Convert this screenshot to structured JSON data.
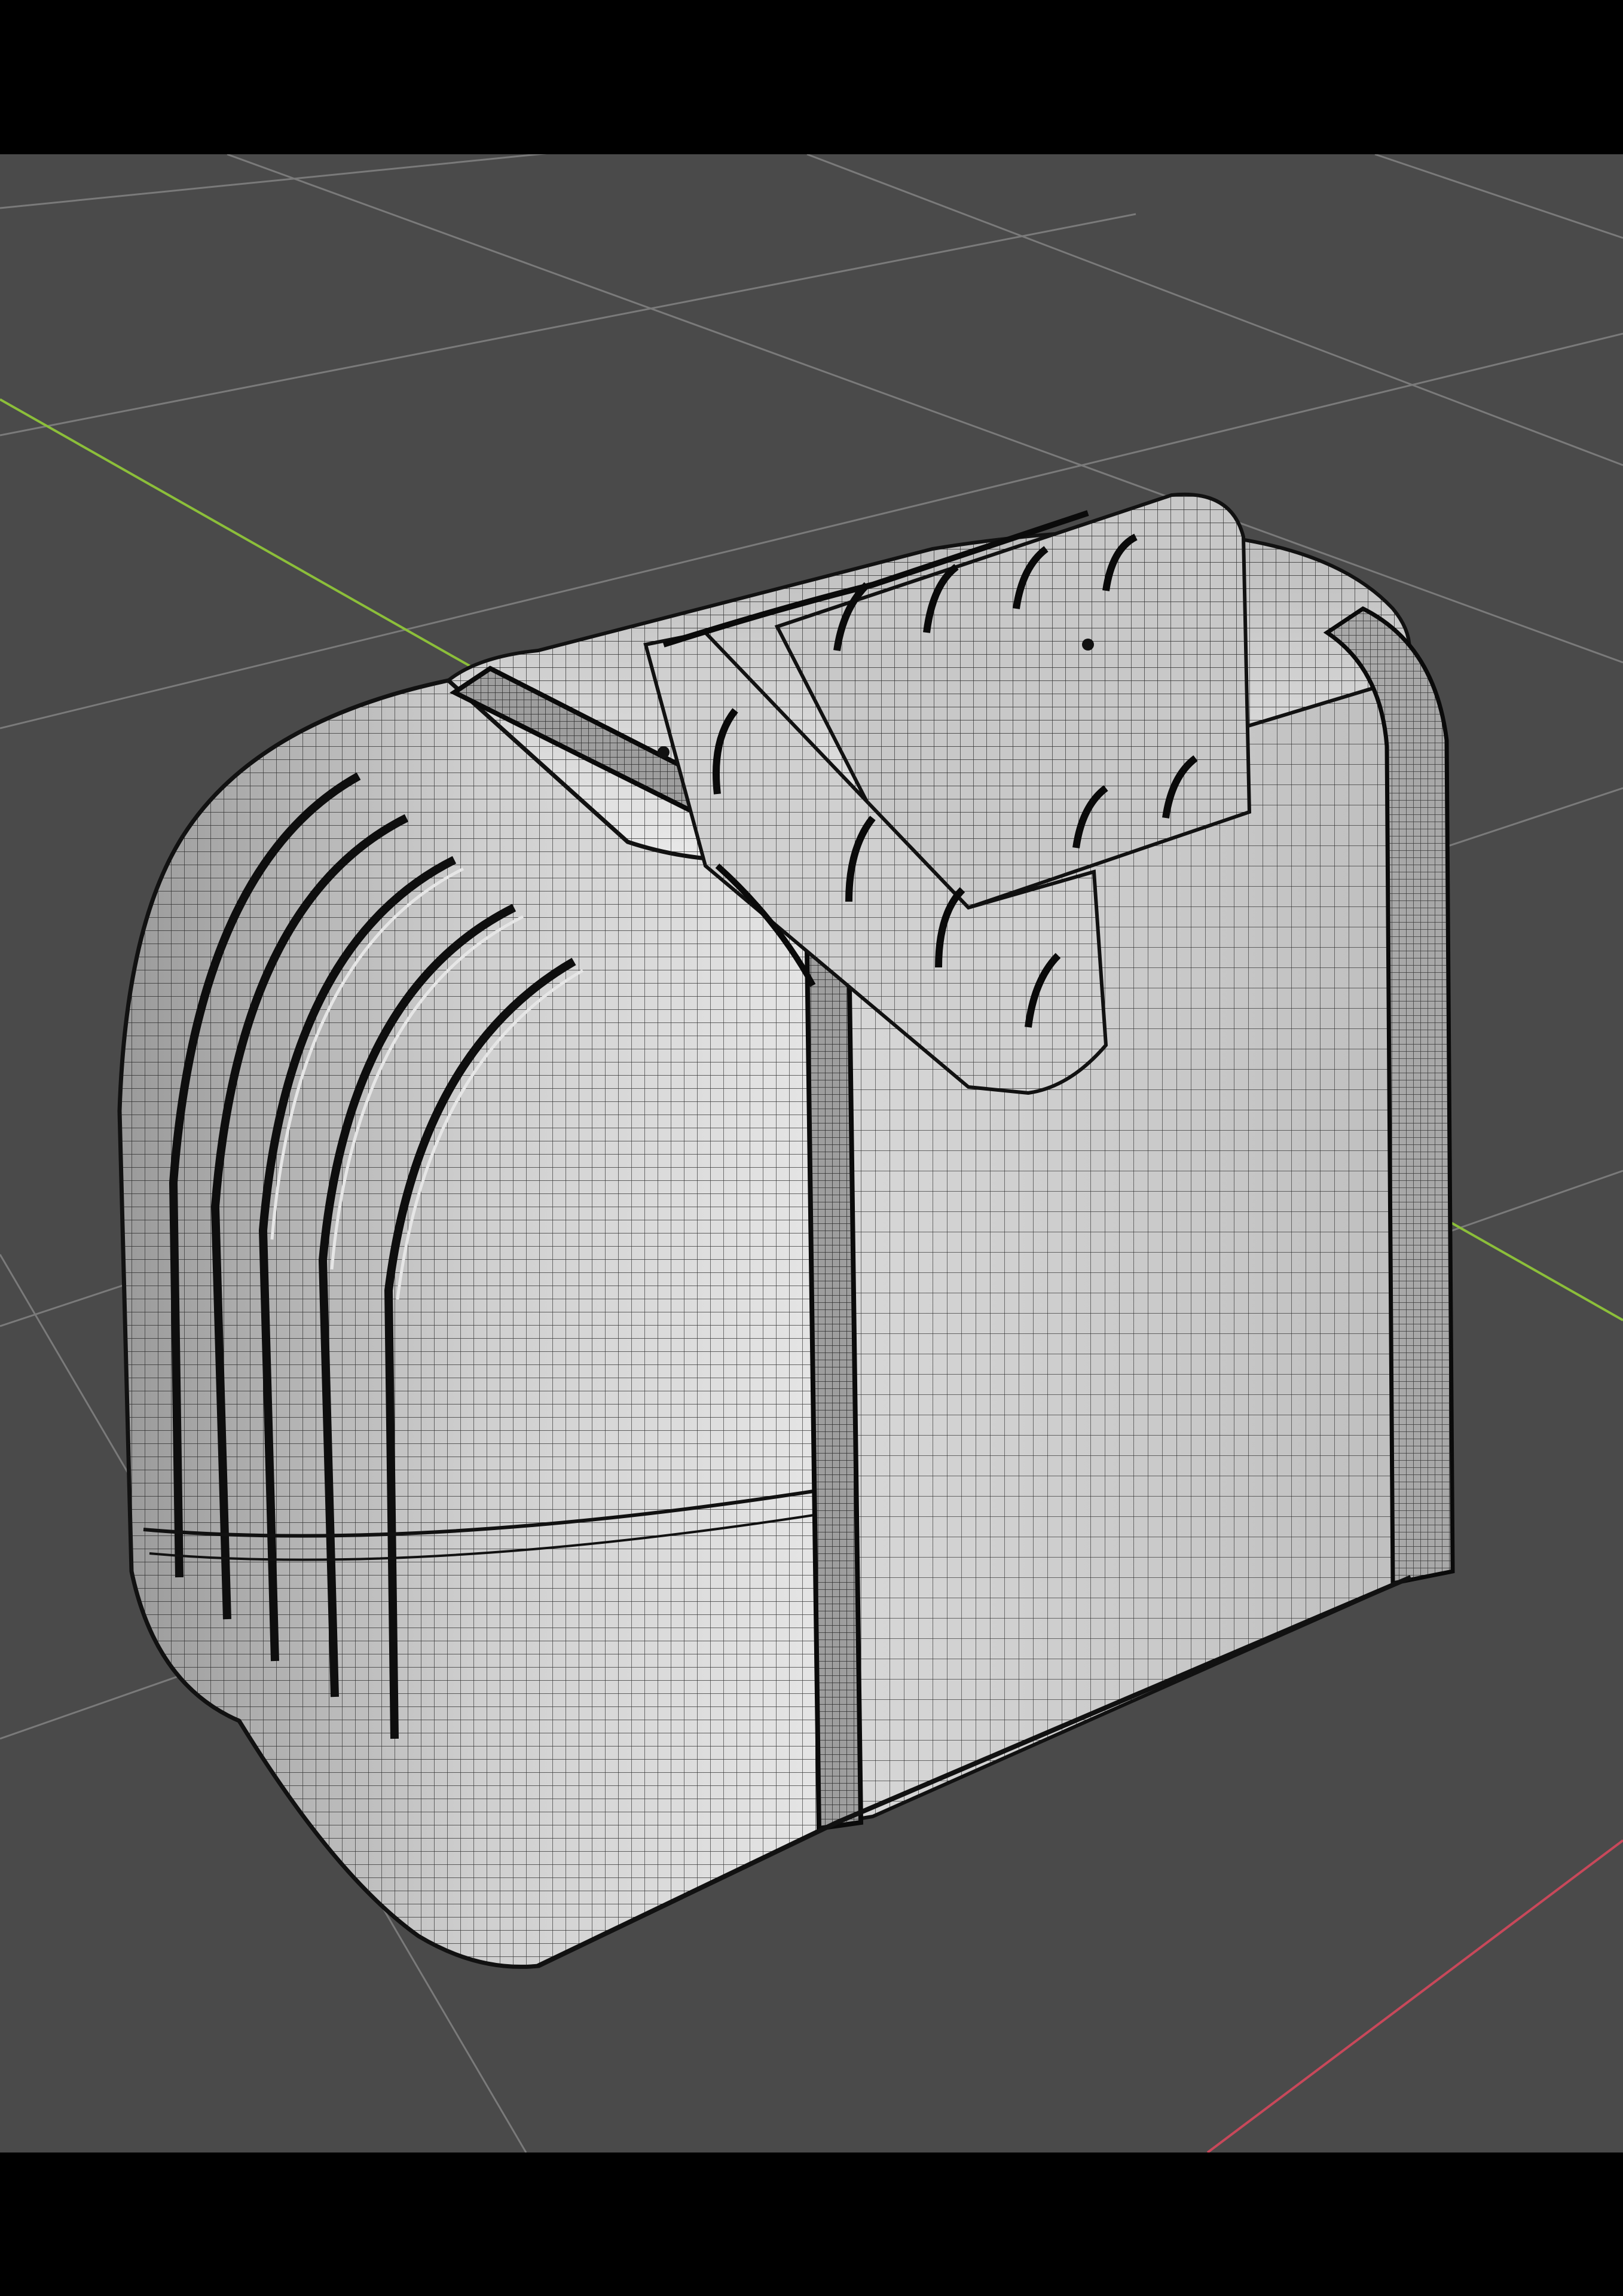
{
  "viewport": {
    "background_color": "#4a4a4a",
    "grid_color": "#7a7a7a",
    "x_axis_color": "#c8485a",
    "y_axis_color": "#8cbf3a",
    "letterbox_color": "#000000"
  },
  "model": {
    "name": "toaster",
    "display_mode": "wireframe",
    "surface_color": "#d9d9d9",
    "wire_color": "#111111"
  }
}
